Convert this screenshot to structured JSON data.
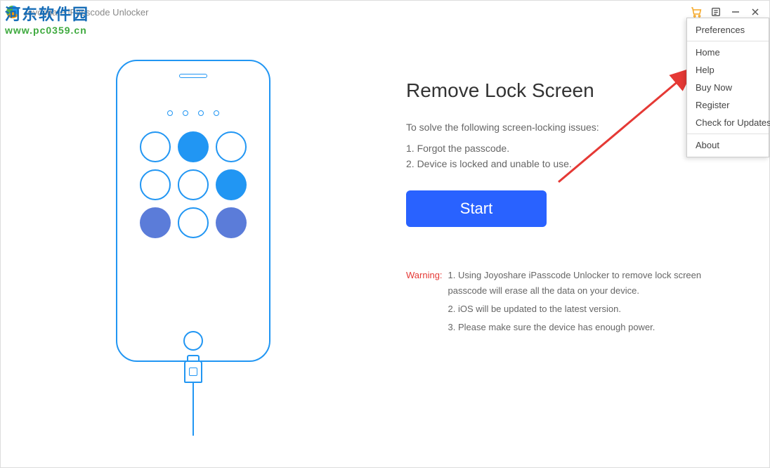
{
  "titlebar": {
    "title": "Joyoshare iPasscode Unlocker"
  },
  "watermark": {
    "line1": "河东软件园",
    "line2": "www.pc0359.cn"
  },
  "menu": {
    "preferences": "Preferences",
    "home": "Home",
    "help": "Help",
    "buy_now": "Buy Now",
    "register": "Register",
    "check_updates": "Check for Updates",
    "about": "About"
  },
  "content": {
    "heading": "Remove Lock Screen",
    "subtext": "To solve the following screen-locking issues:",
    "issue1": "1. Forgot the passcode.",
    "issue2": "2. Device is locked and unable to use.",
    "start_label": "Start",
    "warning_label": "Warning:",
    "warning1": "1. Using Joyoshare iPasscode Unlocker to remove lock screen passcode will erase all the data on your device.",
    "warning2": "2. iOS will be updated to the latest version.",
    "warning3": "3. Please make sure the device has enough power."
  }
}
